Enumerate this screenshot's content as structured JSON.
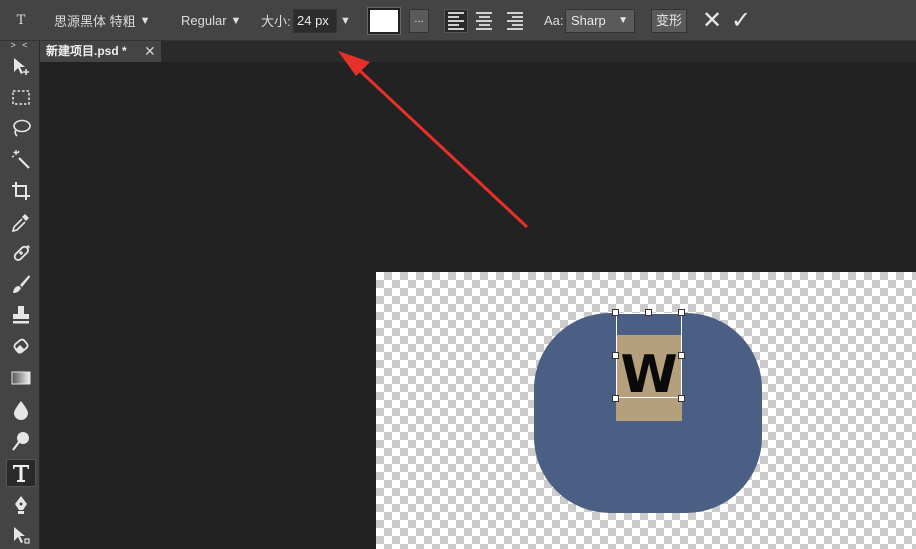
{
  "options_bar": {
    "tool_icon": "type-tool-icon",
    "font_family": "思源黑体 特粗",
    "font_family_arrow": "▼",
    "font_style": "Regular",
    "font_style_arrow": "▼",
    "size_label": "大小:",
    "size_value": "24 px",
    "size_arrow": "▼",
    "text_color": "#ffffff",
    "more_label": "...",
    "align_buttons": [
      "align-left-icon",
      "align-center-icon",
      "align-right-icon"
    ],
    "antialias_label": "Aa:",
    "antialias_value": "Sharp",
    "warp_label": "变形",
    "cancel_icon": "✕",
    "commit_icon": "✓"
  },
  "toolbar": {
    "collapse_label": "> <",
    "tools": [
      "move-tool-icon",
      "marquee-tool-icon",
      "lasso-tool-icon",
      "magic-wand-tool-icon",
      "crop-tool-icon",
      "eyedropper-tool-icon",
      "healing-brush-tool-icon",
      "brush-tool-icon",
      "clone-stamp-tool-icon",
      "eraser-tool-icon",
      "gradient-tool-icon",
      "blur-tool-icon",
      "dodge-tool-icon",
      "type-tool-icon",
      "pen-tool-icon",
      "path-selection-tool-icon"
    ],
    "active_tool": "type-tool-icon"
  },
  "document": {
    "tab_title": "新建项目.psd *",
    "tab_close": "✕"
  },
  "canvas": {
    "shape_color": "#4a5f83",
    "text_box_color": "#b4a07c",
    "text_content": "W"
  },
  "annotation": {
    "arrow_color": "#e8302a"
  }
}
